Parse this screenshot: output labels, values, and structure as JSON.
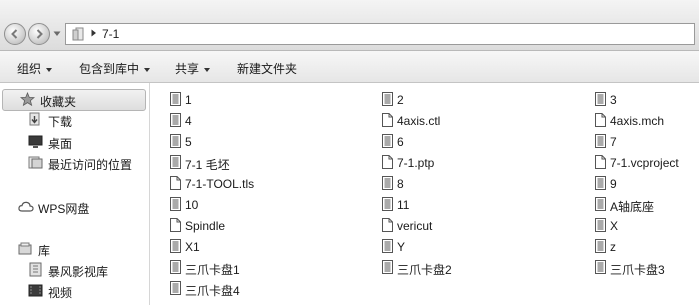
{
  "address": {
    "path": "7-1",
    "icons": {
      "back": "back-arrow-icon",
      "forward": "forward-arrow-icon",
      "history": "chevron-down-icon",
      "folder": "folder-icon",
      "separator": "triangle-right-icon"
    }
  },
  "toolbar": {
    "organize": "组织",
    "include_in_library": "包含到库中",
    "share": "共享",
    "new_folder": "新建文件夹"
  },
  "nav": {
    "favorites": "收藏夹",
    "downloads": "下载",
    "desktop": "桌面",
    "recent": "最近访问的位置",
    "wps": "WPS网盘",
    "libraries": "库",
    "storm_video": "暴风影视库",
    "videos": "视频"
  },
  "files": [
    {
      "name": "1",
      "icon": "doc-icon"
    },
    {
      "name": "2",
      "icon": "doc-icon"
    },
    {
      "name": "3",
      "icon": "doc-icon"
    },
    {
      "name": "4",
      "icon": "doc-icon"
    },
    {
      "name": "4axis.ctl",
      "icon": "blank-file-icon"
    },
    {
      "name": "4axis.mch",
      "icon": "blank-file-icon"
    },
    {
      "name": "5",
      "icon": "doc-icon"
    },
    {
      "name": "6",
      "icon": "doc-icon"
    },
    {
      "name": "7",
      "icon": "doc-icon"
    },
    {
      "name": "7-1 毛坯",
      "icon": "doc-icon"
    },
    {
      "name": "7-1.ptp",
      "icon": "blank-file-icon"
    },
    {
      "name": "7-1.vcproject",
      "icon": "blank-file-icon"
    },
    {
      "name": "7-1-TOOL.tls",
      "icon": "blank-file-icon"
    },
    {
      "name": "8",
      "icon": "doc-icon"
    },
    {
      "name": "9",
      "icon": "doc-icon"
    },
    {
      "name": "10",
      "icon": "doc-icon"
    },
    {
      "name": "11",
      "icon": "doc-icon"
    },
    {
      "name": "A轴底座",
      "icon": "doc-icon"
    },
    {
      "name": "Spindle",
      "icon": "blank-file-icon"
    },
    {
      "name": "vericut",
      "icon": "blank-file-icon"
    },
    {
      "name": "X",
      "icon": "doc-icon"
    },
    {
      "name": "X1",
      "icon": "doc-icon"
    },
    {
      "name": "Y",
      "icon": "doc-icon"
    },
    {
      "name": "z",
      "icon": "doc-icon"
    },
    {
      "name": "三爪卡盘1",
      "icon": "doc-icon"
    },
    {
      "name": "三爪卡盘2",
      "icon": "doc-icon"
    },
    {
      "name": "三爪卡盘3",
      "icon": "doc-icon"
    },
    {
      "name": "三爪卡盘4",
      "icon": "doc-icon"
    }
  ]
}
